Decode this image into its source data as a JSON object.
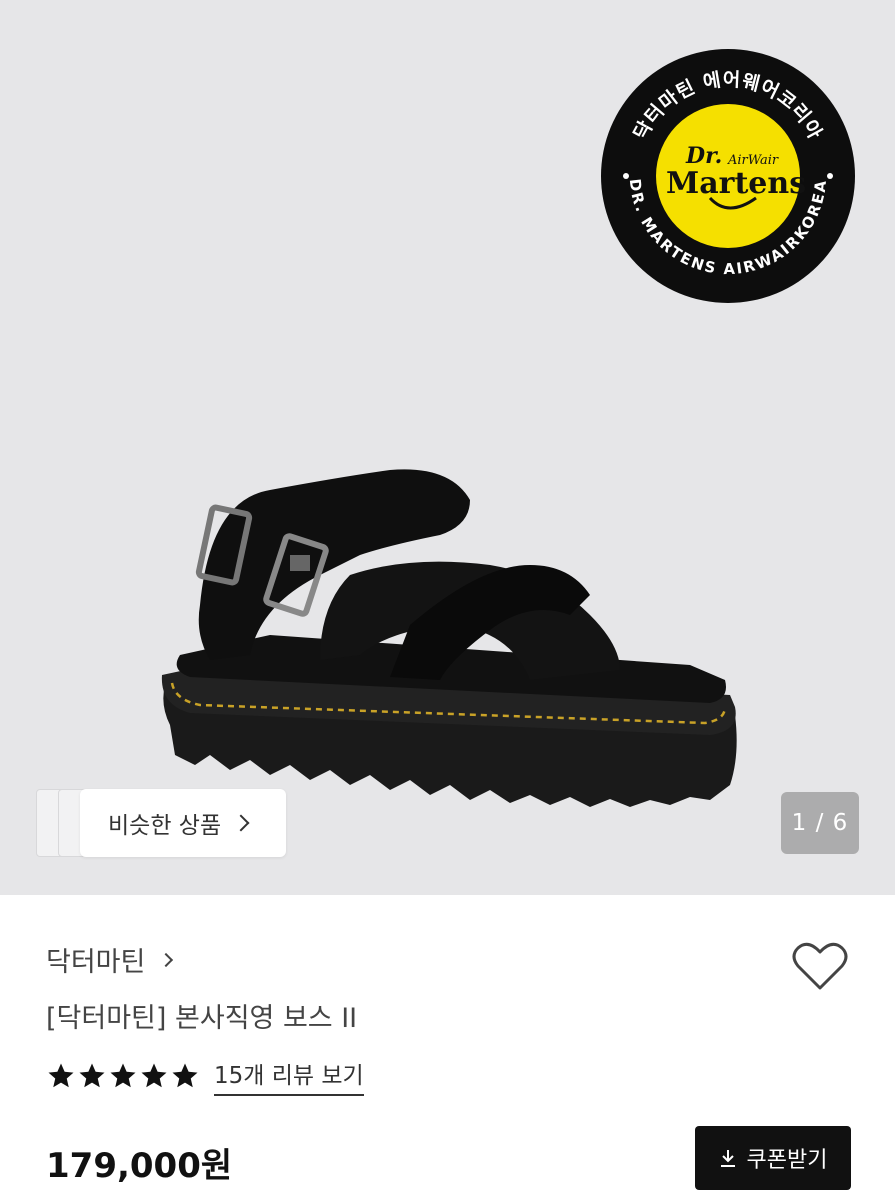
{
  "product_image": {
    "badge_top_text": "닥터마틴 에어웨어코리아",
    "badge_bottom_text": "DR. MARTENS AIRWAIRKOREA",
    "badge_logo_line1": "Dr.",
    "badge_logo_line2": "AirWair",
    "badge_logo_line3": "Martens",
    "image_counter": "1 / 6"
  },
  "similar_products": {
    "label": "비슷한 상품"
  },
  "product": {
    "brand": "닥터마틴",
    "title": "[닥터마틴] 본사직영 보스 II",
    "rating_stars": 5,
    "review_link": "15개 리뷰 보기",
    "price": "179,000원"
  },
  "actions": {
    "coupon_label": "쿠폰받기"
  },
  "icons": {
    "heart": "heart-icon",
    "download": "download-icon",
    "star": "star-icon",
    "chevron": "chevron-right-icon"
  },
  "colors": {
    "badge_yellow": "#f5e000",
    "coupon_bg": "#111111"
  }
}
